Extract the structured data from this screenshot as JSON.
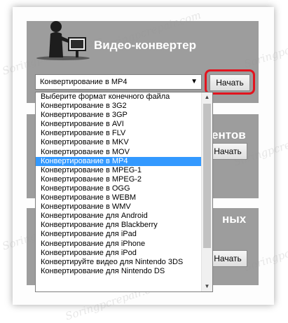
{
  "app": {
    "title": "Видео-конвертер",
    "watermark": "Soringpcrepair.com"
  },
  "format_select": {
    "selected": "Конвертирование в MP4",
    "options": [
      "Выберите формат конечного файла",
      "Конвертирование в 3G2",
      "Конвертирование в 3GP",
      "Конвертирование в AVI",
      "Конвертирование в FLV",
      "Конвертирование в MKV",
      "Конвертирование в MOV",
      "Конвертирование в MP4",
      "Конвертирование в MPEG-1",
      "Конвертирование в MPEG-2",
      "Конвертирование в OGG",
      "Конвертирование в WEBM",
      "Конвертирование в WMV",
      "Конвертирование для Android",
      "Конвертирование для Blackberry",
      "Конвертирование для iPad",
      "Конвертирование для iPhone",
      "Конвертирование для iPod",
      "Конвертируйте видео для Nintendo 3DS",
      "Конвертирование для Nintendo DS"
    ],
    "selected_index": 7
  },
  "buttons": {
    "start_label": "Начать"
  },
  "hidden_panels": {
    "panel2_title_fragment": "ентов",
    "panel3_title_fragment": "ных"
  },
  "colors": {
    "panel_bg": "#9d9d9d",
    "highlight": "#e2141e",
    "selected_option": "#3399ff"
  }
}
